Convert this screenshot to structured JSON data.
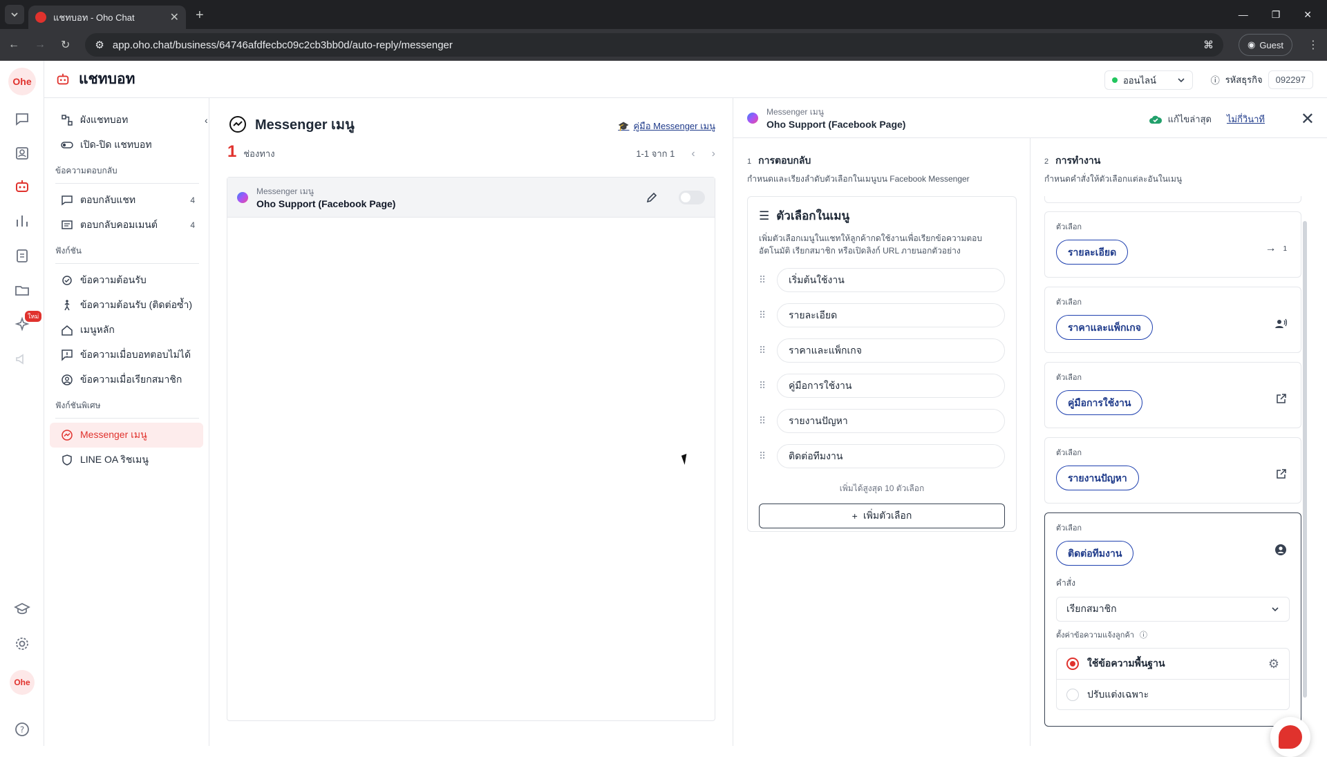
{
  "browser": {
    "tab_title": "แชทบอท - Oho Chat",
    "url": "app.oho.chat/business/64746afdfecbc09c2cb3bb0d/auto-reply/messenger",
    "guest_label": "Guest"
  },
  "header": {
    "title": "แชทบอท",
    "status": "ออนไลน์",
    "business_id_label": "รหัสธุรกิจ",
    "business_id": "092297"
  },
  "rail": {
    "logo_text": "Ohe",
    "new_badge": "ใหม่"
  },
  "sidebar": {
    "items_top": [
      {
        "label": "ผังแชทบอท",
        "icon": "flow-icon"
      },
      {
        "label": "เปิด-ปิด แชทบอท",
        "icon": "toggle-icon"
      }
    ],
    "section_reply": "ข้อความตอบกลับ",
    "items_reply": [
      {
        "label": "ตอบกลับแชท",
        "count": "4"
      },
      {
        "label": "ตอบกลับคอมเมนต์",
        "count": "4"
      }
    ],
    "section_functions": "ฟังก์ชัน",
    "items_functions": [
      {
        "label": "ข้อความต้อนรับ"
      },
      {
        "label": "ข้อความต้อนรับ (ติดต่อซ้ำ)"
      },
      {
        "label": "เมนูหลัก"
      },
      {
        "label": "ข้อความเมื่อบอทตอบไม่ได้"
      },
      {
        "label": "ข้อความเมื่อเรียกสมาชิก"
      }
    ],
    "section_special": "ฟังก์ชันพิเศษ",
    "items_special": [
      {
        "label": "Messenger เมนู",
        "active": true
      },
      {
        "label": "LINE OA ริชเมนู"
      }
    ]
  },
  "center": {
    "title": "Messenger เมนู",
    "guide_link": "คู่มือ Messenger เมนู",
    "count": "1",
    "count_label": "ช่องทาง",
    "pager": "1-1 จาก 1",
    "rows": [
      {
        "subtitle": "Messenger เมนู",
        "name": "Oho Support (Facebook Page)"
      }
    ]
  },
  "detail": {
    "subtitle": "Messenger เมนู",
    "name": "Oho Support (Facebook Page)",
    "saved": "แก้ไขล่าสุด",
    "saved_ago": "ไม่กี่วินาที",
    "step1": {
      "num": "1",
      "title": "การตอบกลับ",
      "desc": "กำหนดและเรียงลำดับตัวเลือกในเมนูบน Facebook Messenger"
    },
    "step2": {
      "num": "2",
      "title": "การทำงาน",
      "desc": "กำหนดคำสั่งให้ตัวเลือกแต่ละอันในเมนู"
    },
    "menu_card": {
      "title": "ตัวเลือกในเมนู",
      "desc": "เพิ่มตัวเลือกเมนูในแชทให้ลูกค้ากดใช้งานเพื่อเรียกข้อความตอบอัตโนมัติ เรียกสมาชิก หรือเปิดลิงก์ URL ภายนอกตัวอย่าง",
      "options": [
        "เริ่มต้นใช้งาน",
        "รายละเอียด",
        "ราคาและแพ็กเกจ",
        "คู่มือการใช้งาน",
        "รายงานปัญหา",
        "ติดต่อทีมงาน"
      ],
      "max_note": "เพิ่มได้สูงสุด 10 ตัวเลือก",
      "add_button": "เพิ่มตัวเลือก"
    },
    "action_label": "ตัวเลือก",
    "actions": [
      {
        "option": "รายละเอียด",
        "icon": "arrow-right-icon",
        "count": "1"
      },
      {
        "option": "ราคาและแพ็กเกจ",
        "icon": "member-call-icon"
      },
      {
        "option": "คู่มือการใช้งาน",
        "icon": "external-link-icon"
      },
      {
        "option": "รายงานปัญหา",
        "icon": "external-link-icon"
      },
      {
        "option": "ติดต่อทีมงาน",
        "icon": "user-circle-icon"
      }
    ],
    "command_label": "คำสั่ง",
    "command_value": "เรียกสมาชิก",
    "notify_label": "ตั้งค่าข้อความแจ้งลูกค้า",
    "radio_default": "ใช้ข้อความพื้นฐาน",
    "radio_custom": "ปรับแต่งเฉพาะ"
  }
}
